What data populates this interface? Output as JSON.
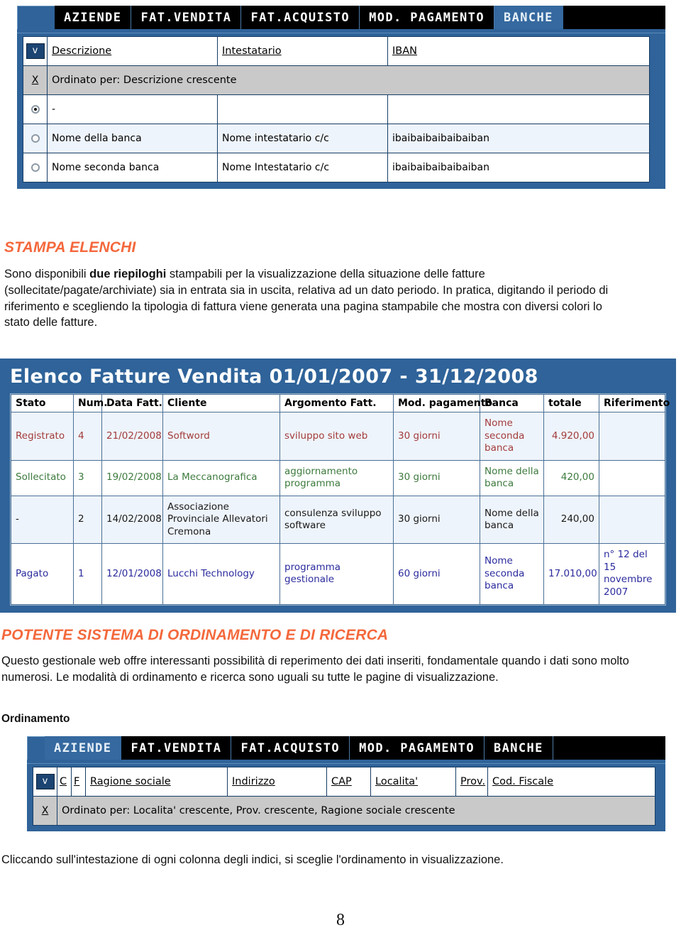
{
  "screenshot_banche": {
    "nav_tabs": [
      {
        "label": "AZIENDE",
        "active": false
      },
      {
        "label": "FAT.VENDITA",
        "active": false
      },
      {
        "label": "FAT.ACQUISTO",
        "active": false
      },
      {
        "label": "MOD. PAGAMENTO",
        "active": false
      },
      {
        "label": "BANCHE",
        "active": true
      }
    ],
    "view_button": "v",
    "clear_link": "X",
    "columns": [
      "Descrizione",
      "Intestatario",
      "IBAN"
    ],
    "sort_text": "Ordinato per: Descrizione crescente",
    "rows": [
      {
        "selected": true,
        "descrizione": "-",
        "intestatario": "",
        "iban": ""
      },
      {
        "selected": false,
        "descrizione": "Nome della banca",
        "intestatario": "Nome intestatario c/c",
        "iban": "ibaibaibaibaibaiban"
      },
      {
        "selected": false,
        "descrizione": "Nome seconda banca",
        "intestatario": "Nome Intestatario c/c",
        "iban": "ibaibaibaibaibaiban"
      }
    ]
  },
  "section_stampa": {
    "heading": "STAMPA ELENCHI",
    "para_1": "Sono disponibili ",
    "para_1_bold": "due riepiloghi",
    "para_2": " stampabili per la visualizzazione della situazione delle fatture (sollecitate/pagate/archiviate) sia in entrata sia in uscita, relativa ad un dato periodo.  In pratica, digitando il periodo di riferimento e scegliendo la tipologia di fattura viene generata una pagina stampabile che mostra con diversi colori lo stato delle fatture."
  },
  "invoice_listing": {
    "title": "Elenco Fatture Vendita 01/01/2007 - 31/12/2008",
    "columns": [
      "Stato",
      "Num.",
      "Data Fatt.",
      "Cliente",
      "Argomento Fatt.",
      "Mod. pagamento",
      "Banca",
      "totale",
      "Riferimento"
    ],
    "rows": [
      {
        "stato": "Registrato",
        "num": "4",
        "data": "21/02/2008",
        "cliente": "Softword",
        "argomento": "sviluppo sito web",
        "pagamento": "30 giorni",
        "banca": "Nome seconda banca",
        "totale": "4.920,00",
        "riferimento": "",
        "color": "#a33b3b",
        "status_class": "c-registrato"
      },
      {
        "stato": "Sollecitato",
        "num": "3",
        "data": "19/02/2008",
        "cliente": "La Meccanografica",
        "argomento": "aggiornamento programma",
        "pagamento": "30 giorni",
        "banca": "Nome della banca",
        "totale": "420,00",
        "riferimento": "",
        "color": "#3d7a3d",
        "status_class": "c-sollecitato"
      },
      {
        "stato": "-",
        "num": "2",
        "data": "14/02/2008",
        "cliente": "Associazione Provinciale Allevatori Cremona",
        "argomento": "consulenza sviluppo software",
        "pagamento": "30 giorni",
        "banca": "Nome della banca",
        "totale": "240,00",
        "riferimento": "",
        "color": "#1a1a1a",
        "status_class": "c-none"
      },
      {
        "stato": "Pagato",
        "num": "1",
        "data": "12/01/2008",
        "cliente": "Lucchi Technology",
        "argomento": "programma gestionale",
        "pagamento": "60 giorni",
        "banca": "Nome seconda banca",
        "totale": "17.010,00",
        "riferimento": "n° 12 del 15 novembre 2007",
        "color": "#2b2b9e",
        "status_class": "c-pagato"
      }
    ]
  },
  "section_ordinamento": {
    "heading": "POTENTE SISTEMA DI ORDINAMENTO E DI RICERCA",
    "para": "Questo gestionale web offre interessanti possibilità di reperimento dei dati inseriti, fondamentale quando i dati sono molto numerosi. Le modalità di ordinamento e ricerca sono uguali su tutte le pagine di visualizzazione.",
    "subheading": "Ordinamento"
  },
  "screenshot_aziende": {
    "nav_tabs": [
      {
        "label": "AZIENDE",
        "active": true
      },
      {
        "label": "FAT.VENDITA",
        "active": false
      },
      {
        "label": "FAT.ACQUISTO",
        "active": false
      },
      {
        "label": "MOD. PAGAMENTO",
        "active": false
      },
      {
        "label": "BANCHE",
        "active": false
      }
    ],
    "view_button": "v",
    "clear_link": "X",
    "columns": [
      "C",
      "F",
      "Ragione sociale",
      "Indirizzo",
      "CAP",
      "Localita'",
      "Prov.",
      "Cod. Fiscale"
    ],
    "sort_text": "Ordinato per: Localita' crescente, Prov. crescente, Ragione sociale crescente"
  },
  "caption_bottom": "Cliccando sull'intestazione di ogni colonna degli indici, si sceglie l'ordinamento in visualizzazione.",
  "page_number": "8",
  "colors": {
    "accent_heading": "#F4683C",
    "app_chrome_blue": "#2f6399",
    "nav_black": "#000000",
    "nav_active": "#35699f",
    "grid_border": "#173d66",
    "sort_row_bg": "#c9c9c9",
    "row_alt_bg": "#eef4fb"
  }
}
